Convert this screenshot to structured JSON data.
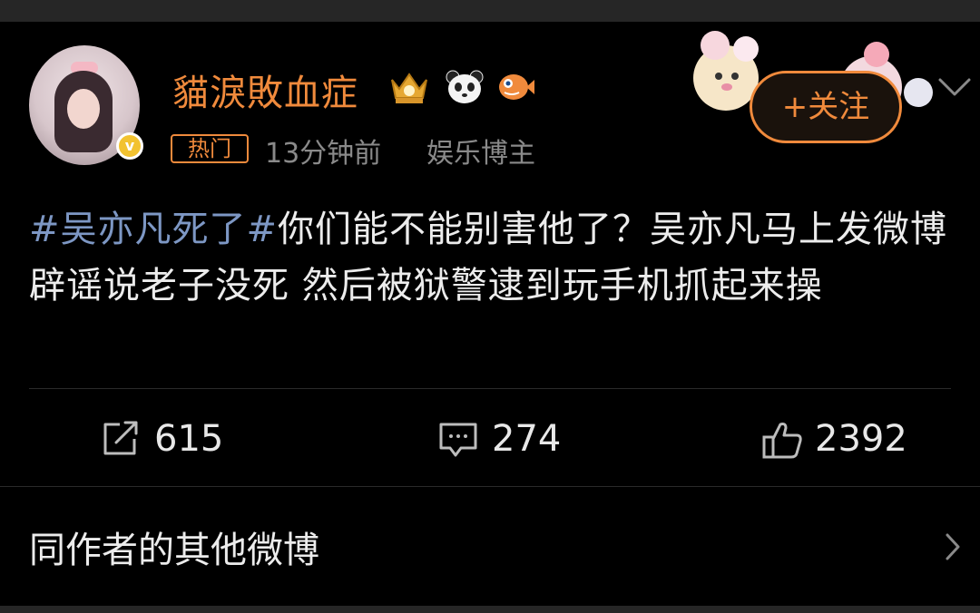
{
  "user": {
    "name": "貓淚敗血症",
    "hot_tag": "热门",
    "time": "13分钟前",
    "role": "娱乐博主",
    "verified_badge": "v"
  },
  "follow": {
    "label": "+关注"
  },
  "post": {
    "hashtag": "#吴亦凡死了#",
    "text": "你们能不能别害他了？吴亦凡马上发微博辟谣说老子没死 然后被狱警逮到玩手机抓起来操"
  },
  "actions": {
    "repost_count": "615",
    "comment_count": "274",
    "like_count": "2392"
  },
  "more": {
    "label": "同作者的其他微博"
  },
  "colors": {
    "accent": "#f08a3c",
    "hashtag": "#7d97c4",
    "muted": "#8a8a8a",
    "background": "#000000"
  }
}
